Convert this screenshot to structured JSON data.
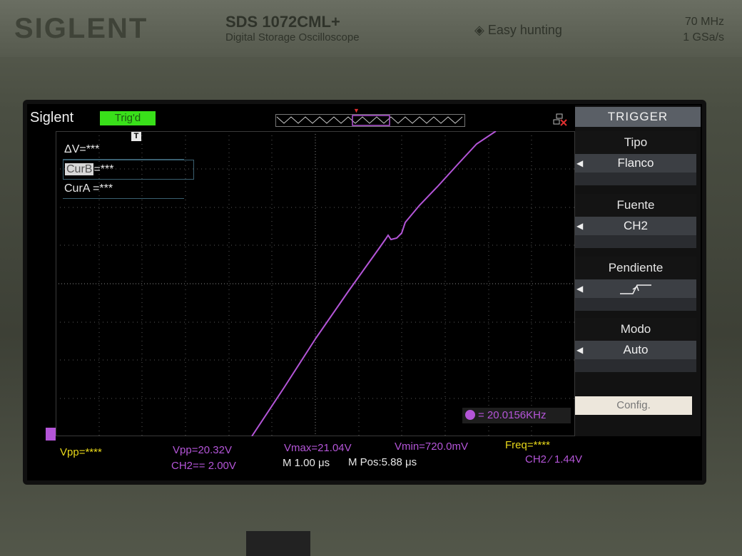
{
  "device": {
    "brand": "SIGLENT",
    "model": "SDS 1072CML+",
    "model_subtitle": "Digital Storage Oscilloscope",
    "easy_hunting": "Easy hunting",
    "bandwidth": "70 MHz",
    "sample_rate": "1 GSa/s"
  },
  "screen": {
    "logo": "Siglent",
    "trigger_status": "Trig'd",
    "cursor_marker": "T",
    "cursors": {
      "delta_v": "ΔV=***",
      "cur_b_label": "CurB",
      "cur_b_value": "=***",
      "cur_a": "CurA =***"
    },
    "frequency_readout": "= 20.0156KHz"
  },
  "menu": {
    "title": "TRIGGER",
    "items": [
      {
        "label": "Tipo",
        "value": "Flanco"
      },
      {
        "label": "Fuente",
        "value": "CH2"
      },
      {
        "label": "Pendiente",
        "value": ""
      },
      {
        "label": "Modo",
        "value": "Auto"
      }
    ],
    "config_label": "Config."
  },
  "status": {
    "ch1_vpp": "Vpp=****",
    "ch2_vpp": "Vpp=20.32V",
    "vmax": "Vmax=21.04V",
    "vmin": "Vmin=720.0mV",
    "freq": "Freq=****",
    "ch2_scale": "CH2== 2.00V",
    "timebase": "M 1.00 μs",
    "mpos": "M Pos:5.88 μs",
    "trigger_level": "CH2 ⁄ 1.44V"
  },
  "colors": {
    "trace": "#b455d8",
    "trig_status": "#39e01a",
    "ch1": "#e8d81a"
  }
}
